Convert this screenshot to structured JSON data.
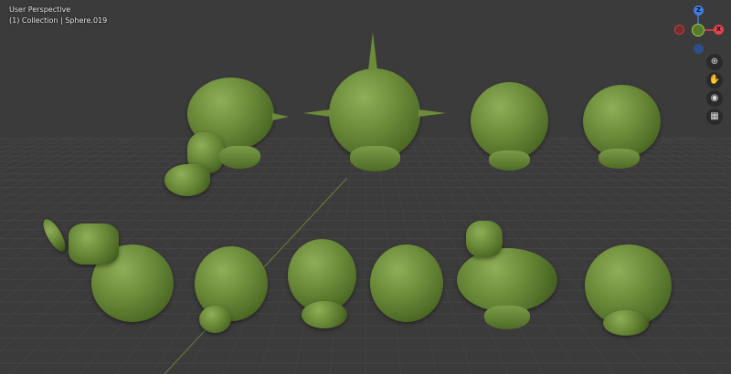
{
  "viewport": {
    "view_name": "User Perspective",
    "collection_info": "(1) Collection | Sphere.019"
  },
  "gizmo": {
    "z_label": "Z",
    "x_label": "X",
    "colors": {
      "x": "#e0444e",
      "y": "#8bc34a",
      "z": "#3d7de6"
    }
  },
  "nav_buttons": [
    {
      "icon": "zoom-icon",
      "glyph": "⊕"
    },
    {
      "icon": "hand-pan-icon",
      "glyph": "✋"
    },
    {
      "icon": "camera-icon",
      "glyph": "◉"
    },
    {
      "icon": "grid-perspective-icon",
      "glyph": "▦"
    }
  ]
}
